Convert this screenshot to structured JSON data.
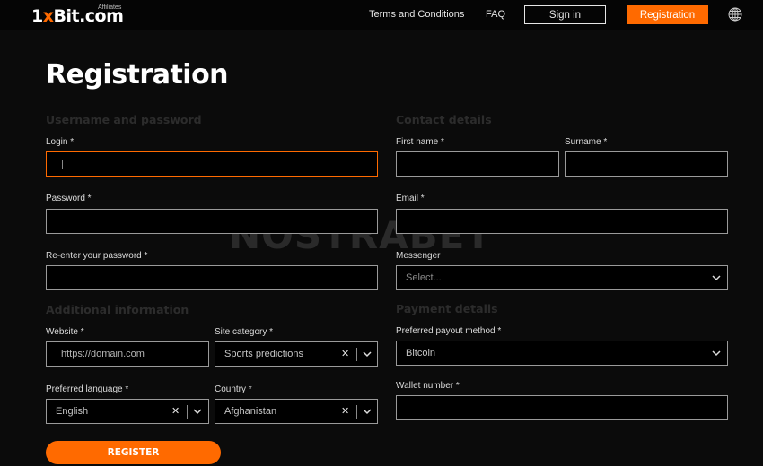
{
  "header": {
    "logo_prefix": "1",
    "logo_x": "x",
    "logo_main": "Bit.com",
    "logo_sub": "Affiliates",
    "nav": [
      {
        "label": "Terms and Conditions"
      },
      {
        "label": "FAQ"
      }
    ],
    "signin_label": "Sign in",
    "registration_label": "Registration",
    "language_icon": "globe-icon"
  },
  "page": {
    "title": "Registration",
    "watermark": "NOSTRABET"
  },
  "sections": {
    "username_password": "Username and password",
    "contact_details": "Contact details",
    "additional_information": "Additional information",
    "payment_details": "Payment details"
  },
  "fields": {
    "login": {
      "label": "Login *",
      "value": ""
    },
    "password": {
      "label": "Password *",
      "value": ""
    },
    "repassword": {
      "label": "Re-enter your password *",
      "value": ""
    },
    "first_name": {
      "label": "First name *",
      "value": ""
    },
    "surname": {
      "label": "Surname *",
      "value": ""
    },
    "email": {
      "label": "Email *",
      "value": ""
    },
    "messenger": {
      "label": "Messenger",
      "placeholder": "Select..."
    },
    "website": {
      "label": "Website *",
      "placeholder": "https://domain.com"
    },
    "site_category": {
      "label": "Site category *",
      "value": "Sports predictions"
    },
    "preferred_language": {
      "label": "Preferred language *",
      "value": "English"
    },
    "country": {
      "label": "Country *",
      "value": "Afghanistan"
    },
    "payout_method": {
      "label": "Preferred payout method *",
      "value": "Bitcoin"
    },
    "wallet": {
      "label": "Wallet number *",
      "value": ""
    }
  },
  "register_button": "REGISTER",
  "colors": {
    "accent": "#ff6a00",
    "background": "#0b0b0b",
    "field_border": "#9a9a9a"
  }
}
